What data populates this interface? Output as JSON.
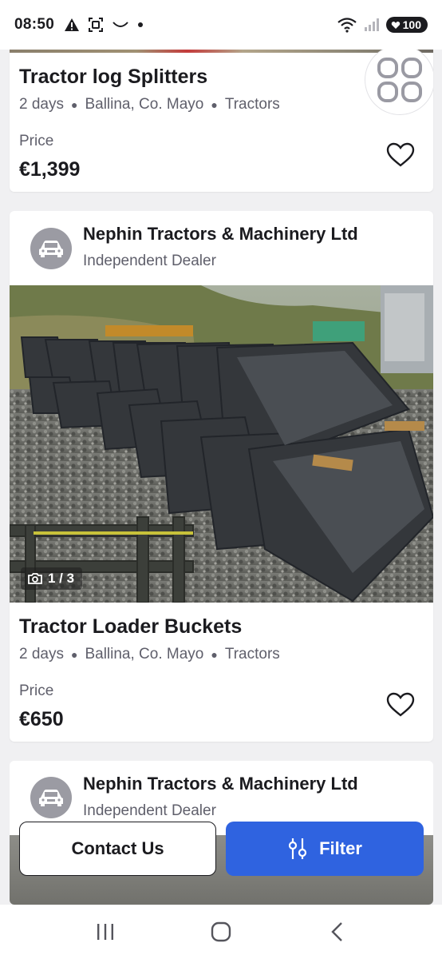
{
  "status_bar": {
    "time": "08:50",
    "left_icons": [
      "warning-icon",
      "screenshot-icon",
      "rotate-icon",
      "dot-icon"
    ],
    "right_icons": [
      "wifi-icon",
      "signal-icon"
    ],
    "battery": "100"
  },
  "listings": [
    {
      "title": "Tractor log Splitters",
      "age": "2 days",
      "location": "Ballina, Co. Mayo",
      "category": "Tractors",
      "price_label": "Price",
      "price": "€1,399"
    },
    {
      "dealer_name": "Nephin Tractors & Machinery Ltd",
      "dealer_type": "Independent Dealer",
      "photo_counter": "1 / 3",
      "title": "Tractor Loader Buckets",
      "age": "2 days",
      "location": "Ballina, Co. Mayo",
      "category": "Tractors",
      "price_label": "Price",
      "price": "€650"
    },
    {
      "dealer_name": "Nephin Tractors & Machinery Ltd",
      "dealer_type": "Independent Dealer"
    }
  ],
  "actions": {
    "contact_label": "Contact Us",
    "filter_label": "Filter"
  },
  "colors": {
    "primary": "#2f63e0",
    "text": "#1b1b1f",
    "muted": "#5f5f6b",
    "background": "#f0f0f2"
  }
}
